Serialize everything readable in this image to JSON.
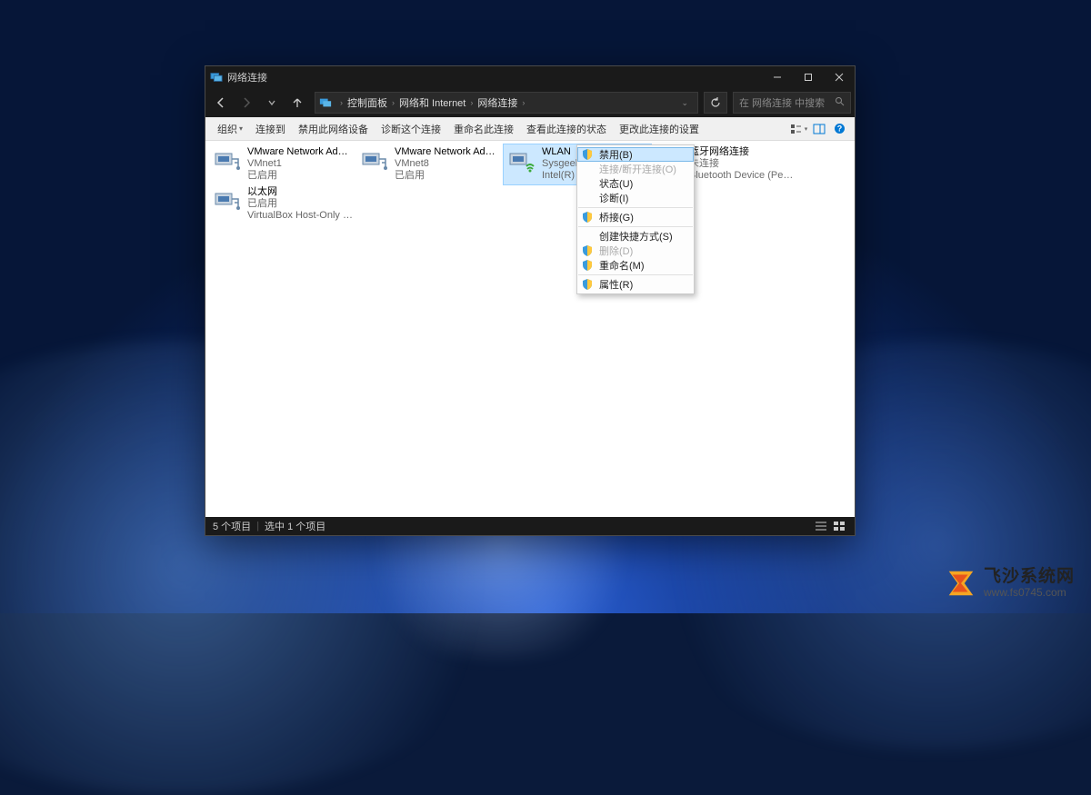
{
  "window": {
    "title": "网络连接"
  },
  "breadcrumb": {
    "items": [
      "控制面板",
      "网络和 Internet",
      "网络连接"
    ]
  },
  "search": {
    "placeholder": "在 网络连接 中搜索"
  },
  "toolbar": {
    "organize": "组织",
    "connect": "连接到",
    "disable": "禁用此网络设备",
    "diagnose": "诊断这个连接",
    "rename": "重命名此连接",
    "status": "查看此连接的状态",
    "change": "更改此连接的设置"
  },
  "adapters": [
    {
      "name": "VMware Network Adapter",
      "line2": "VMnet1",
      "line3": "已启用",
      "type": "eth"
    },
    {
      "name": "VMware Network Adapter",
      "line2": "VMnet8",
      "line3": "已启用",
      "type": "eth"
    },
    {
      "name": "WLAN",
      "line2": "Sysgeek 2",
      "line3": "Intel(R) Wirel...",
      "type": "wifi",
      "selected": true
    },
    {
      "name": "蓝牙网络连接",
      "line2": "未连接",
      "line3": "Bluetooth Device (Personal Ar...",
      "type": "bt",
      "partially_hidden": true
    },
    {
      "name": "以太网",
      "line2": "已启用",
      "line3": "VirtualBox Host-Only Ethernet ...",
      "type": "eth"
    }
  ],
  "context_menu": {
    "items": [
      {
        "label": "禁用(B)",
        "shield": true,
        "highlighted": true
      },
      {
        "label": "连接/断开连接(O)",
        "disabled": true
      },
      {
        "label": "状态(U)"
      },
      {
        "label": "诊断(I)"
      },
      {
        "sep": true
      },
      {
        "label": "桥接(G)",
        "shield": true
      },
      {
        "sep": true
      },
      {
        "label": "创建快捷方式(S)"
      },
      {
        "label": "删除(D)",
        "shield": true,
        "disabled": true
      },
      {
        "label": "重命名(M)",
        "shield": true
      },
      {
        "sep": true
      },
      {
        "label": "属性(R)",
        "shield": true
      }
    ]
  },
  "statusbar": {
    "count": "5 个项目",
    "selected": "选中 1 个项目"
  },
  "watermark": {
    "title": "飞沙系统网",
    "url": "www.fs0745.com"
  }
}
